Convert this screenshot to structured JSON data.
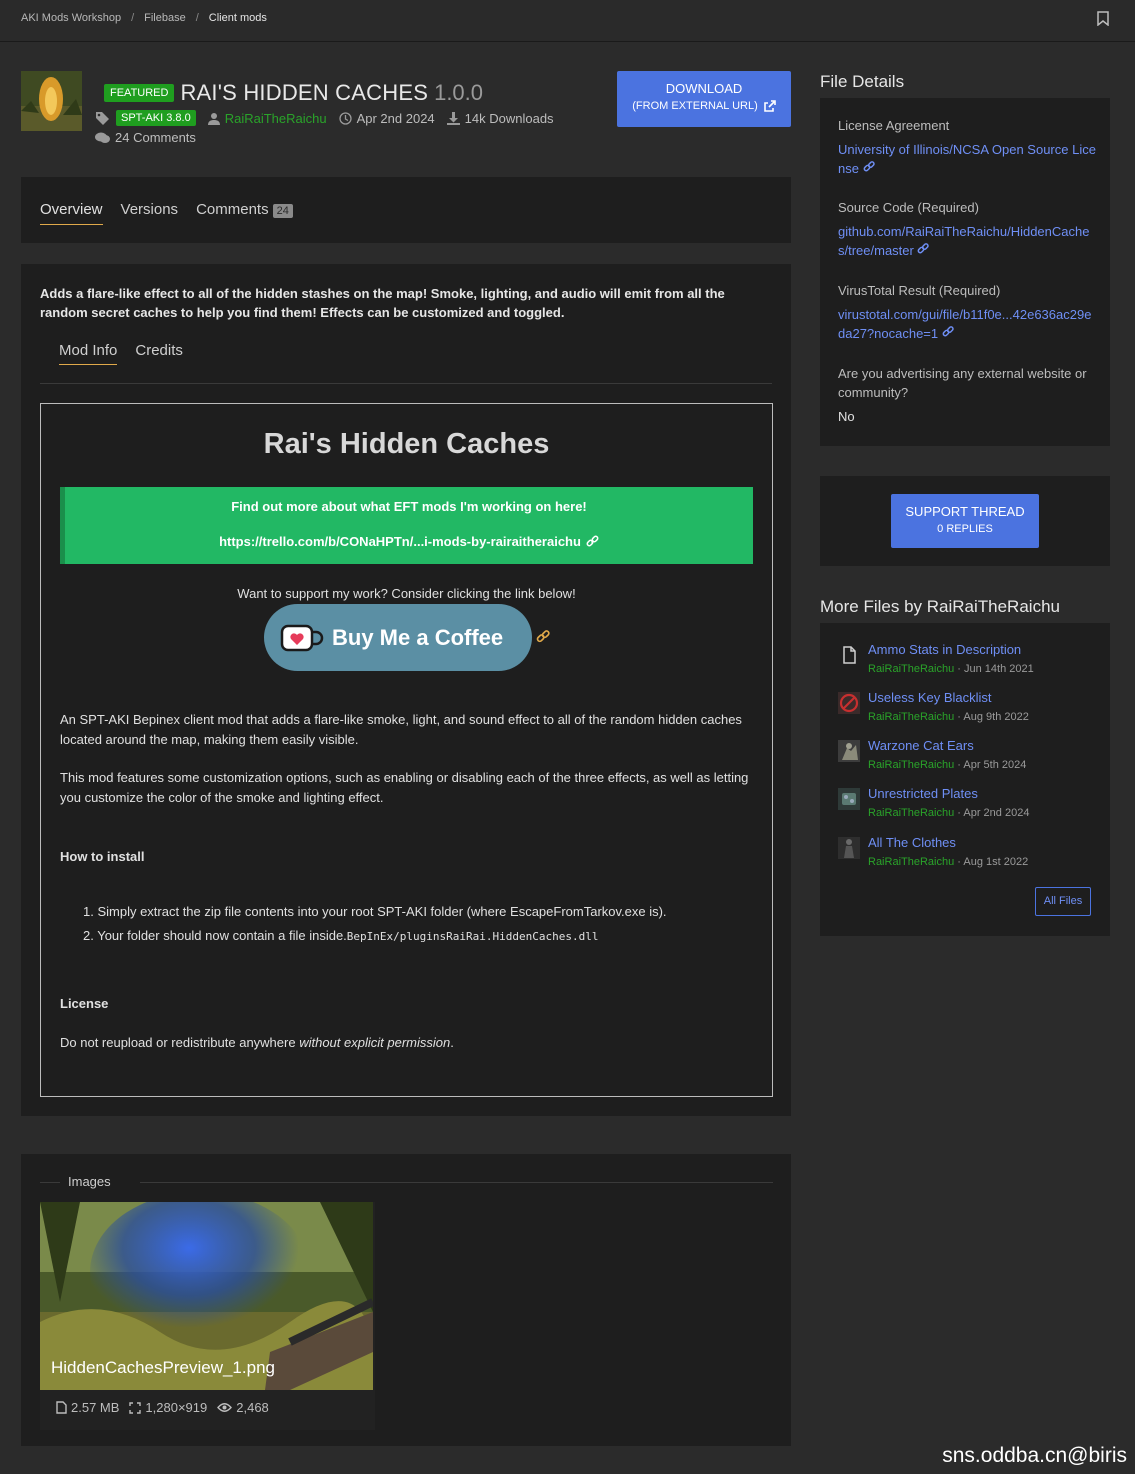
{
  "breadcrumb": [
    "AKI Mods Workshop",
    "Filebase",
    "Client mods"
  ],
  "header": {
    "featured": "FEATURED",
    "title": "RAI'S HIDDEN CACHES",
    "version": "1.0.0",
    "tag": "SPT-AKI 3.8.0",
    "author": "RaiRaiTheRaichu",
    "date": "Apr 2nd 2024",
    "downloads": "14k Downloads",
    "comments": "24 Comments"
  },
  "download": {
    "label": "DOWNLOAD",
    "sub": "(FROM EXTERNAL URL)"
  },
  "tabs": [
    {
      "label": "Overview"
    },
    {
      "label": "Versions"
    },
    {
      "label": "Comments",
      "count": "24"
    }
  ],
  "main": {
    "summary": "Adds a flare-like effect to all of the hidden stashes on the map! Smoke, lighting, and audio will emit from all the random secret caches to help you find them! Effects can be customized and toggled.",
    "subtabs": [
      "Mod Info",
      "Credits"
    ],
    "desc_title": "Rai's Hidden Caches",
    "green_line1": "Find out more about what EFT mods I'm working on here!",
    "green_line2": "https://trello.com/b/CONaHPTn/...i-mods-by-rairaitheraichu",
    "support_text": "Want to support my work? Consider clicking the link below!",
    "coffee": "Buy Me a Coffee",
    "para1": "An SPT-AKI Bepinex client mod that adds a flare-like smoke, light, and sound effect to all of the random hidden caches located around the map, making them easily visible.",
    "para2": "This mod features some customization options, such as enabling or disabling each of the three effects, as well as letting you customize the color of the smoke and lighting effect.",
    "install_h": "How to install",
    "step1": "1. Simply extract the zip file contents into your root SPT-AKI folder (where EscapeFromTarkov.exe is).",
    "step2_text": "2. Your folder should now contain a file inside.",
    "step2_code": "BepInEx/pluginsRaiRai.HiddenCaches.dll",
    "license_h": "License",
    "license_text": "Do not reupload or redistribute anywhere ",
    "license_em": "without explicit permission",
    "license_end": "."
  },
  "images": {
    "legend": "Images",
    "name": "HiddenCachesPreview_1.png",
    "size": "2.57 MB",
    "dims": "1,280×919",
    "views": "2,468"
  },
  "sidebar": {
    "details_title": "File Details",
    "license_label": "License Agreement",
    "license_value": "University of Illinois/NCSA Open Source License",
    "source_label": "Source Code (Required)",
    "source_value": "github.com/RaiRaiTheRaichu/HiddenCaches/tree/master",
    "virus_label": "VirusTotal Result (Required)",
    "virus_value": "virustotal.com/gui/file/b11f0e...42e636ac29eda27?nocache=1",
    "advert_label": "Are you advertising any external website or community?",
    "advert_value": "No",
    "support_label": "SUPPORT THREAD",
    "support_sub": "0 REPLIES",
    "more_title": "More Files by RaiRaiTheRaichu",
    "more_files": [
      {
        "name": "Ammo Stats in Description",
        "author": "RaiRaiTheRaichu",
        "date": " · Jun 14th 2021"
      },
      {
        "name": "Useless Key Blacklist",
        "author": "RaiRaiTheRaichu",
        "date": " · Aug 9th 2022"
      },
      {
        "name": "Warzone Cat Ears",
        "author": "RaiRaiTheRaichu",
        "date": " · Apr 5th 2024"
      },
      {
        "name": "Unrestricted Plates",
        "author": "RaiRaiTheRaichu",
        "date": " · Apr 2nd 2024"
      },
      {
        "name": "All The Clothes",
        "author": "RaiRaiTheRaichu",
        "date": " · Aug 1st 2022"
      }
    ],
    "all_files": "All Files"
  },
  "watermark": "sns.oddba.cn@biris",
  "colors": {
    "accent": "#4b73e0",
    "featured": "#1f9e1f",
    "promo": "#22b864",
    "tab_underline": "#e0a94a"
  }
}
